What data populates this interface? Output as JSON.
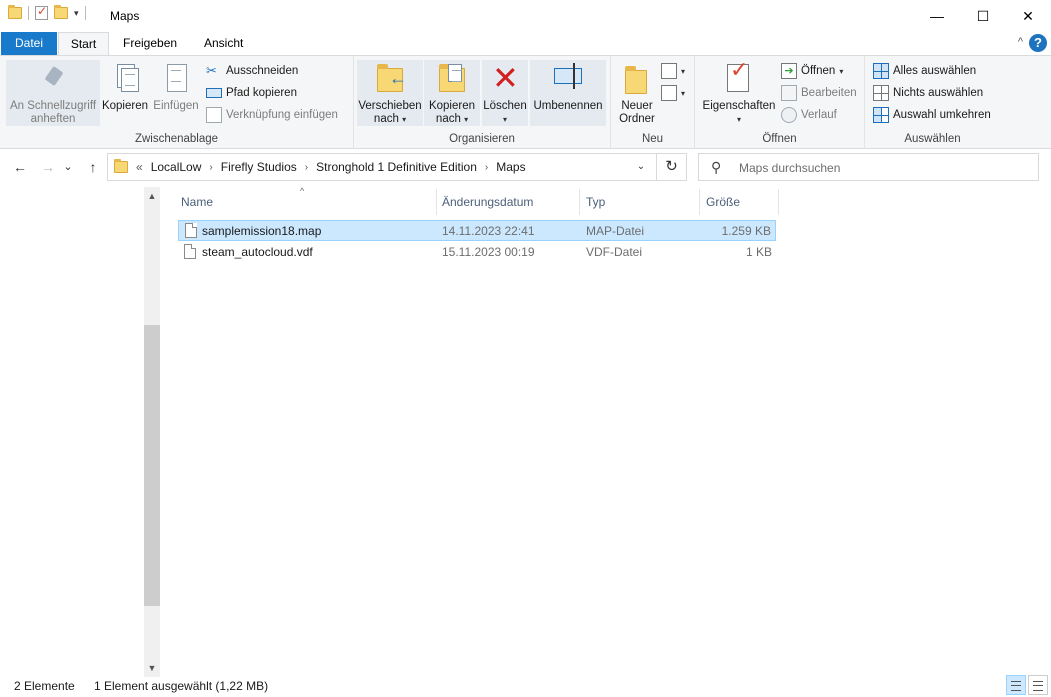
{
  "window": {
    "title": "Maps",
    "minimize_glyph": "—",
    "maximize_glyph": "☐",
    "close_glyph": "✕",
    "qat_dropdown_glyph": "▾"
  },
  "ribbon_tabs": {
    "file": "Datei",
    "start": "Start",
    "share": "Freigeben",
    "view": "Ansicht",
    "help": "?",
    "collapse_glyph": "^"
  },
  "ribbon": {
    "clipboard": {
      "label": "Zwischenablage",
      "pin_quick_access": "An Schnellzugriff anheften",
      "copy": "Kopieren",
      "paste": "Einfügen",
      "cut": "Ausschneiden",
      "copy_path": "Pfad kopieren",
      "paste_shortcut": "Verknüpfung einfügen"
    },
    "organize": {
      "label": "Organisieren",
      "move_to_line1": "Verschieben",
      "move_to_line2": "nach",
      "copy_to_line1": "Kopieren",
      "copy_to_line2": "nach",
      "delete": "Löschen",
      "rename": "Umbenennen"
    },
    "new": {
      "label": "Neu",
      "new_folder_line1": "Neuer",
      "new_folder_line2": "Ordner"
    },
    "open": {
      "label": "Öffnen",
      "properties": "Eigenschaften",
      "open": "Öffnen",
      "edit": "Bearbeiten",
      "history": "Verlauf"
    },
    "select": {
      "label": "Auswählen",
      "select_all": "Alles auswählen",
      "select_none": "Nichts auswählen",
      "invert_selection": "Auswahl umkehren"
    }
  },
  "navigation": {
    "back_glyph": "←",
    "forward_glyph": "→",
    "recent_glyph": "⌄",
    "up_glyph": "↑",
    "overflow": "«",
    "breadcrumbs": [
      "LocalLow",
      "Firefly Studios",
      "Stronghold 1 Definitive Edition",
      "Maps"
    ],
    "crumb_separator": "›",
    "dropdown_glyph": "⌄",
    "refresh_glyph": "↻",
    "search_placeholder": "Maps durchsuchen",
    "search_glyph": "⚲"
  },
  "file_list": {
    "columns": {
      "name": "Name",
      "date": "Änderungsdatum",
      "type": "Typ",
      "size": "Größe"
    },
    "sort_glyph": "^",
    "rows": [
      {
        "name": "samplemission18.map",
        "date": "14.11.2023 22:41",
        "type": "MAP-Datei",
        "size": "1.259 KB",
        "selected": true
      },
      {
        "name": "steam_autocloud.vdf",
        "date": "15.11.2023 00:19",
        "type": "VDF-Datei",
        "size": "1 KB",
        "selected": false
      }
    ]
  },
  "scrollbar": {
    "up_glyph": "▲",
    "down_glyph": "▼"
  },
  "status_bar": {
    "item_count": "2 Elemente",
    "selection": "1 Element ausgewählt (1,22 MB)"
  },
  "colors": {
    "file_tab": "#1979ca",
    "selection_bg": "#cce8ff",
    "selection_border": "#99d1ff",
    "ribbon_bg": "#f5f6f7",
    "folder_yellow": "#f8d775",
    "delete_red": "#d11f1f"
  }
}
